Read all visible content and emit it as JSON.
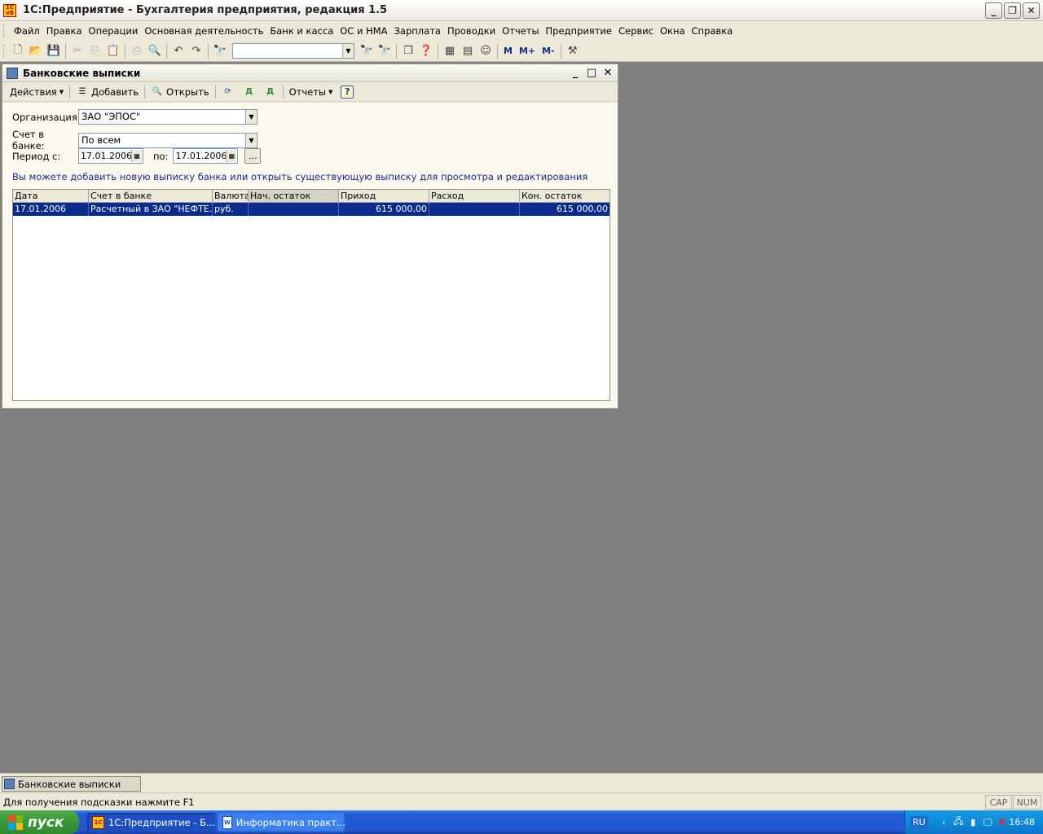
{
  "app": {
    "title": "1С:Предприятие - Бухгалтерия предприятия, редакция 1.5",
    "icon_text": "1C v8"
  },
  "menu": [
    "Файл",
    "Правка",
    "Операции",
    "Основная деятельность",
    "Банк и касса",
    "ОС и НМА",
    "Зарплата",
    "Проводки",
    "Отчеты",
    "Предприятие",
    "Сервис",
    "Окна",
    "Справка"
  ],
  "toolbar": {
    "search_value": "",
    "mem_buttons": [
      "M",
      "M+",
      "M-"
    ]
  },
  "window": {
    "title": "Банковские выписки",
    "actions_label": "Действия",
    "add_label": "Добавить",
    "open_label": "Открыть",
    "reports_label": "Отчеты",
    "help_label": "?"
  },
  "form": {
    "org_label": "Организация:",
    "org_value": "ЗАО \"ЭПОС\"",
    "account_label": "Счет в банке:",
    "account_value": "По всем",
    "period_label": "Период с:",
    "period_from": "17.01.2006",
    "period_to_label": "по:",
    "period_to": "17.01.2006",
    "period_btn": "...",
    "hint": "Вы можете добавить новую выписку банка или открыть существующую выписку для просмотра и редактирования"
  },
  "table": {
    "columns": [
      "Дата",
      "Счет в банке",
      "Валюта",
      "Нач. остаток",
      "Приход",
      "Расход",
      "Кон. остаток"
    ],
    "rows": [
      {
        "date": "17.01.2006",
        "account": "Расчетный в ЗАО \"НЕФТЕ...",
        "currency": "руб.",
        "start": "",
        "income": "615 000,00",
        "expense": "",
        "end": "615 000,00"
      }
    ]
  },
  "mdi_tab": "Банковские выписки",
  "status": {
    "text": "Для получения подсказки нажмите F1",
    "cap": "CAP",
    "num": "NUM"
  },
  "taskbar": {
    "start": "пуск",
    "buttons": [
      "1С:Предприятие - Б...",
      "Информатика практ..."
    ],
    "lang": "RU",
    "clock": "16:48"
  },
  "colors": {
    "selection": "#0a2a8c",
    "hint": "#1b2a8c",
    "desktop": "#808080"
  }
}
